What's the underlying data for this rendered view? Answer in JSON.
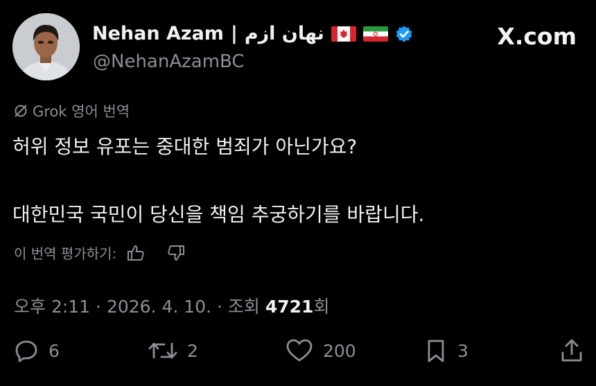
{
  "header": {
    "name": "Nehan Azam",
    "separator": "|",
    "name_alt": "نهان ازم",
    "handle": "@NehanAzamBC",
    "brand": "X.com"
  },
  "translation": {
    "note": "Grok 영어 번역"
  },
  "tweet": {
    "line1": "허위 정보 유포는 중대한 범죄가 아닌가요?",
    "line2": "대한민국 국민이 당신을 책임 추궁하기를 바랍니다."
  },
  "rate": {
    "label": "이 번역 평가하기:"
  },
  "meta": {
    "time": "오후 2:11",
    "dot1": "·",
    "date": "2026. 4. 10.",
    "dot2": "·",
    "views_label": "조회",
    "views_count": "4721",
    "views_suffix": "회"
  },
  "actions": {
    "replies": "6",
    "reposts": "2",
    "likes": "200",
    "bookmarks": "3"
  },
  "colors": {
    "background": "#000000",
    "text": "#e7e9ea",
    "muted": "#8b9096",
    "verified": "#1d9bf0"
  },
  "icons": [
    "user-avatar",
    "canada-flag-icon",
    "iran-flag-icon",
    "verified-badge-icon",
    "slash-icon",
    "thumbs-up-icon",
    "thumbs-down-icon",
    "reply-icon",
    "repost-icon",
    "like-icon",
    "bookmark-icon",
    "share-icon"
  ]
}
